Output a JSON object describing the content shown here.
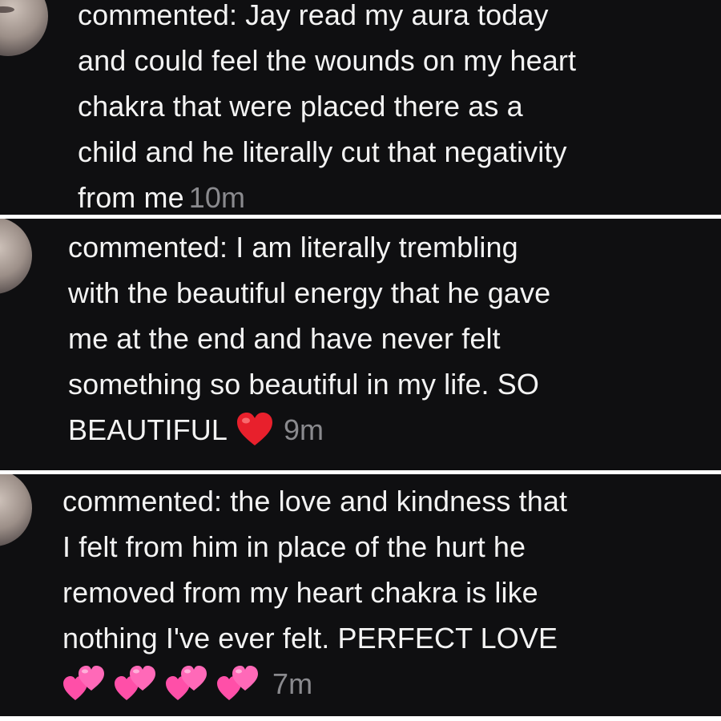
{
  "comments": [
    {
      "lines": [
        "commented: Jay read my aura today",
        "and could feel the wounds on my heart",
        "chakra that were placed there as a",
        "child and he literally cut that negativity",
        "from me"
      ],
      "time": "10m"
    },
    {
      "lines": [
        "commented: I am literally trembling",
        "with the beautiful energy that he gave",
        "me at the end and have never felt",
        "something so beautiful in my life. SO",
        "BEAUTIFUL"
      ],
      "emoji": "red-heart-icon",
      "time": "9m"
    },
    {
      "lines": [
        "commented: the love and kindness that",
        "I felt from him in place of the hurt he",
        "removed from my heart chakra is like",
        "nothing I've ever felt. PERFECT LOVE"
      ],
      "emoji": "two-hearts-icon",
      "emoji_count": 4,
      "time": "7m"
    }
  ],
  "colors": {
    "background": "#0f0f11",
    "text": "#f3f3f3",
    "timestamp": "#8a8a8e",
    "heart_red": "#e8202c",
    "heart_pink": "#ff5fb4"
  }
}
